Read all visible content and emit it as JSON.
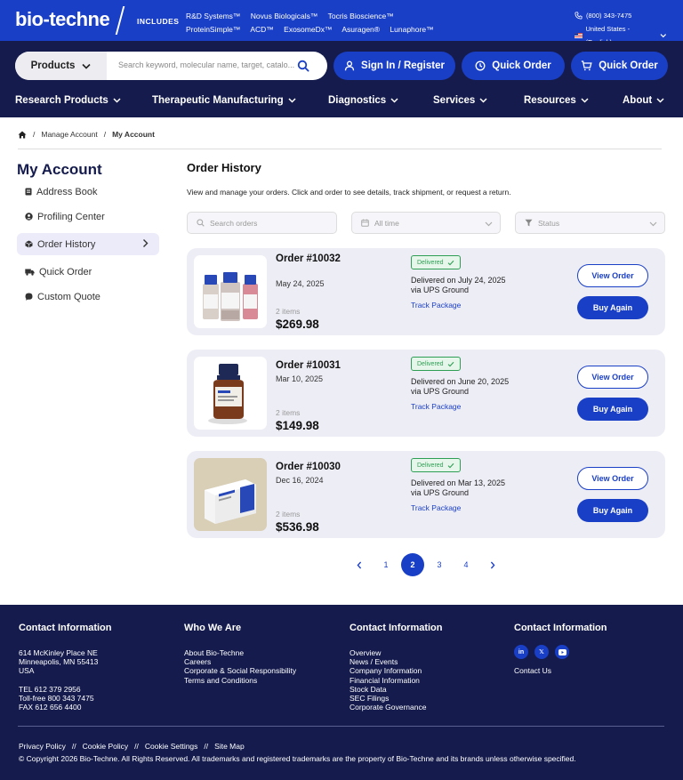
{
  "brand": {
    "logo": "bio-techne",
    "includes_label": "INCLUDES",
    "brands_row1": [
      "R&D Systems™",
      "Novus Biologicals™",
      "Tocris Bioscience™"
    ],
    "brands_row2": [
      "ProteinSimple™",
      "ACD™",
      "ExosomeDx™",
      "Asuragen®",
      "Lunaphore™"
    ],
    "phone": "(800) 343-7475",
    "locale": "United States - (English)"
  },
  "search": {
    "category": "Products",
    "placeholder": "Search keyword, molecular name, target, catalo..."
  },
  "actions": {
    "sign_in": "Sign In / Register",
    "quick_order_1": "Quick Order",
    "quick_order_2": "Quick Order"
  },
  "nav": [
    "Research Products",
    "Therapeutic Manufacturing",
    "Diagnostics",
    "Services",
    "Resources",
    "About"
  ],
  "breadcrumb": {
    "manage": "Manage Account",
    "current": "My Account"
  },
  "sidebar": {
    "title": "My Account",
    "items": [
      "Address Book",
      "Profiling Center",
      "Order History",
      "Quick Order",
      "Custom Quote"
    ]
  },
  "main": {
    "title": "Order History",
    "description": "View and manage your orders. Click and order to see details, track shipment, or request a return.",
    "filters": {
      "search_placeholder": "Search orders",
      "time": "All time",
      "status": "Status"
    }
  },
  "orders": [
    {
      "number": "Order #10032",
      "date": "May 24, 2025",
      "items": "2 items",
      "total": "$269.98",
      "status": "Delivered",
      "delivered": "Delivered on July 24, 2025",
      "carrier": "via UPS Ground",
      "track": "Track Package",
      "view": "View Order",
      "buy": "Buy Again"
    },
    {
      "number": "Order #10031",
      "date": "Mar 10, 2025",
      "items": "2 items",
      "total": "$149.98",
      "status": "Delivered",
      "delivered": "Delivered on June 20, 2025",
      "carrier": "via UPS Ground",
      "track": "Track Package",
      "view": "View Order",
      "buy": "Buy Again"
    },
    {
      "number": "Order #10030",
      "date": "Dec 16, 2024",
      "items": "2 items",
      "total": "$536.98",
      "status": "Delivered",
      "delivered": "Delivered on Mar 13, 2025",
      "carrier": "via UPS Ground",
      "track": "Track Package",
      "view": "View Order",
      "buy": "Buy Again"
    }
  ],
  "pagination": {
    "pages": [
      "1",
      "2",
      "3",
      "4"
    ],
    "current": "2"
  },
  "footer": {
    "col1": {
      "title": "Contact Information",
      "address": [
        "614 McKinley Place NE",
        "Minneapolis, MN 55413",
        "USA"
      ],
      "phones": [
        "TEL 612 379 2956",
        "Toll-free 800 343 7475",
        "FAX 612 656 4400"
      ]
    },
    "col2": {
      "title": "Who We Are",
      "links": [
        "About Bio-Techne",
        "Careers",
        "Corporate & Social Responsibility",
        "Terms and Conditions"
      ]
    },
    "col3": {
      "title": "Contact Information",
      "links": [
        "Overview",
        "News / Events",
        "Company Information",
        "Financial Information",
        "Stock Data",
        "SEC Filings",
        "Corporate Governance"
      ]
    },
    "col4": {
      "title": "Contact Information",
      "contact_us": "Contact Us"
    },
    "legal": [
      "Privacy Policy",
      "Cookie Policy",
      "Cookie Settings",
      "Site Map"
    ],
    "separator": "//",
    "copyright": "© Copyright 2026 Bio-Techne. All Rights Reserved. All trademarks and registered trademarks are the property of Bio-Techne and its brands unless otherwise specified."
  },
  "colors": {
    "primary": "#1a3fc7",
    "navy": "#151c4d",
    "card_bg": "#ededf6",
    "delivered_green": "#2e9e55"
  }
}
